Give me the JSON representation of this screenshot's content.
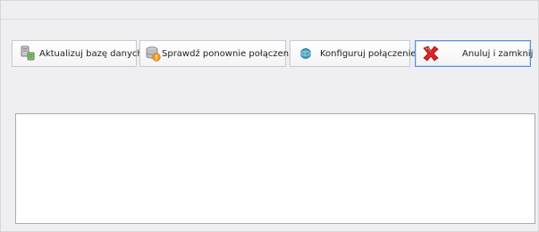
{
  "toolbar": {
    "update_db_label": "Aktualizuj bazę danych",
    "recheck_label": "Sprawdź ponownie połączenie",
    "configure_label": "Konfiguruj połączenie",
    "cancel_close_label": "Anuluj i zamknij"
  },
  "icons": {
    "update_db": "database-update-icon",
    "recheck": "database-warning-icon",
    "configure": "globe-settings-icon",
    "cancel_close": "red-x-icon"
  },
  "colors": {
    "focus_border": "#5b8fd6",
    "cancel_x": "#d9242b"
  },
  "output": {
    "text": ""
  }
}
